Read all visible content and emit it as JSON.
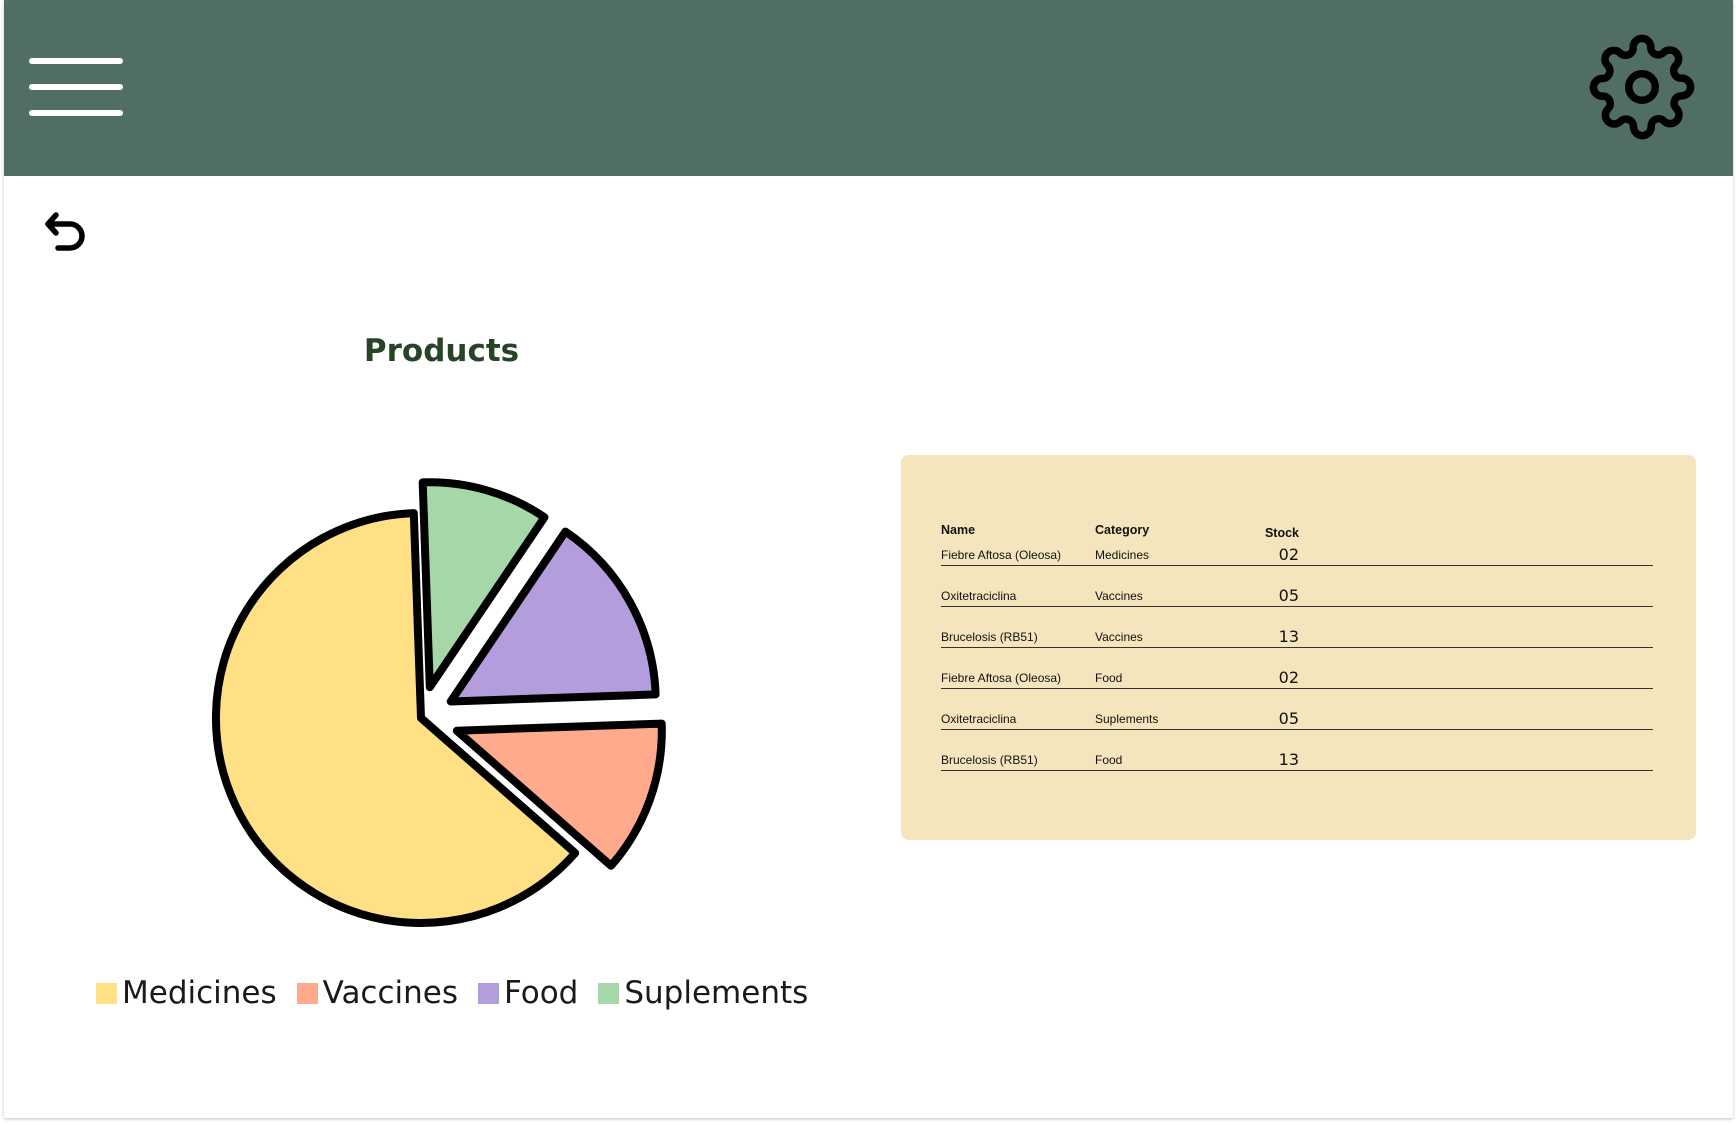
{
  "header": {
    "menu_icon": "hamburger-menu-icon",
    "settings_icon": "gear-icon",
    "background_color": "#516e66"
  },
  "toolbar": {
    "back_icon": "undo-arrow-icon"
  },
  "chart_data": {
    "type": "pie",
    "title": "Products",
    "exploded": true,
    "series": [
      {
        "name": "Medicines",
        "value": 63,
        "color": "#ffe085"
      },
      {
        "name": "Vaccines",
        "value": 12,
        "color": "#ffaa8c"
      },
      {
        "name": "Food",
        "value": 15,
        "color": "#b39ddc"
      },
      {
        "name": "Suplements",
        "value": 10,
        "color": "#a6d7a8"
      }
    ],
    "legend_position": "bottom"
  },
  "table": {
    "headers": {
      "name": "Name",
      "category": "Category",
      "stock": "Stock"
    },
    "rows": [
      {
        "name": "Fiebre Aftosa (Oleosa)",
        "category": "Medicines",
        "stock": "02"
      },
      {
        "name": "Oxitetraciclina",
        "category": "Vaccines",
        "stock": "05"
      },
      {
        "name": "Brucelosis (RB51)",
        "category": "Vaccines",
        "stock": "13"
      },
      {
        "name": "Fiebre Aftosa (Oleosa)",
        "category": "Food",
        "stock": "02"
      },
      {
        "name": "Oxitetraciclina",
        "category": "Suplements",
        "stock": "05"
      },
      {
        "name": "Brucelosis (RB51)",
        "category": "Food",
        "stock": "13"
      }
    ],
    "background_color": "#f5e5bd"
  }
}
